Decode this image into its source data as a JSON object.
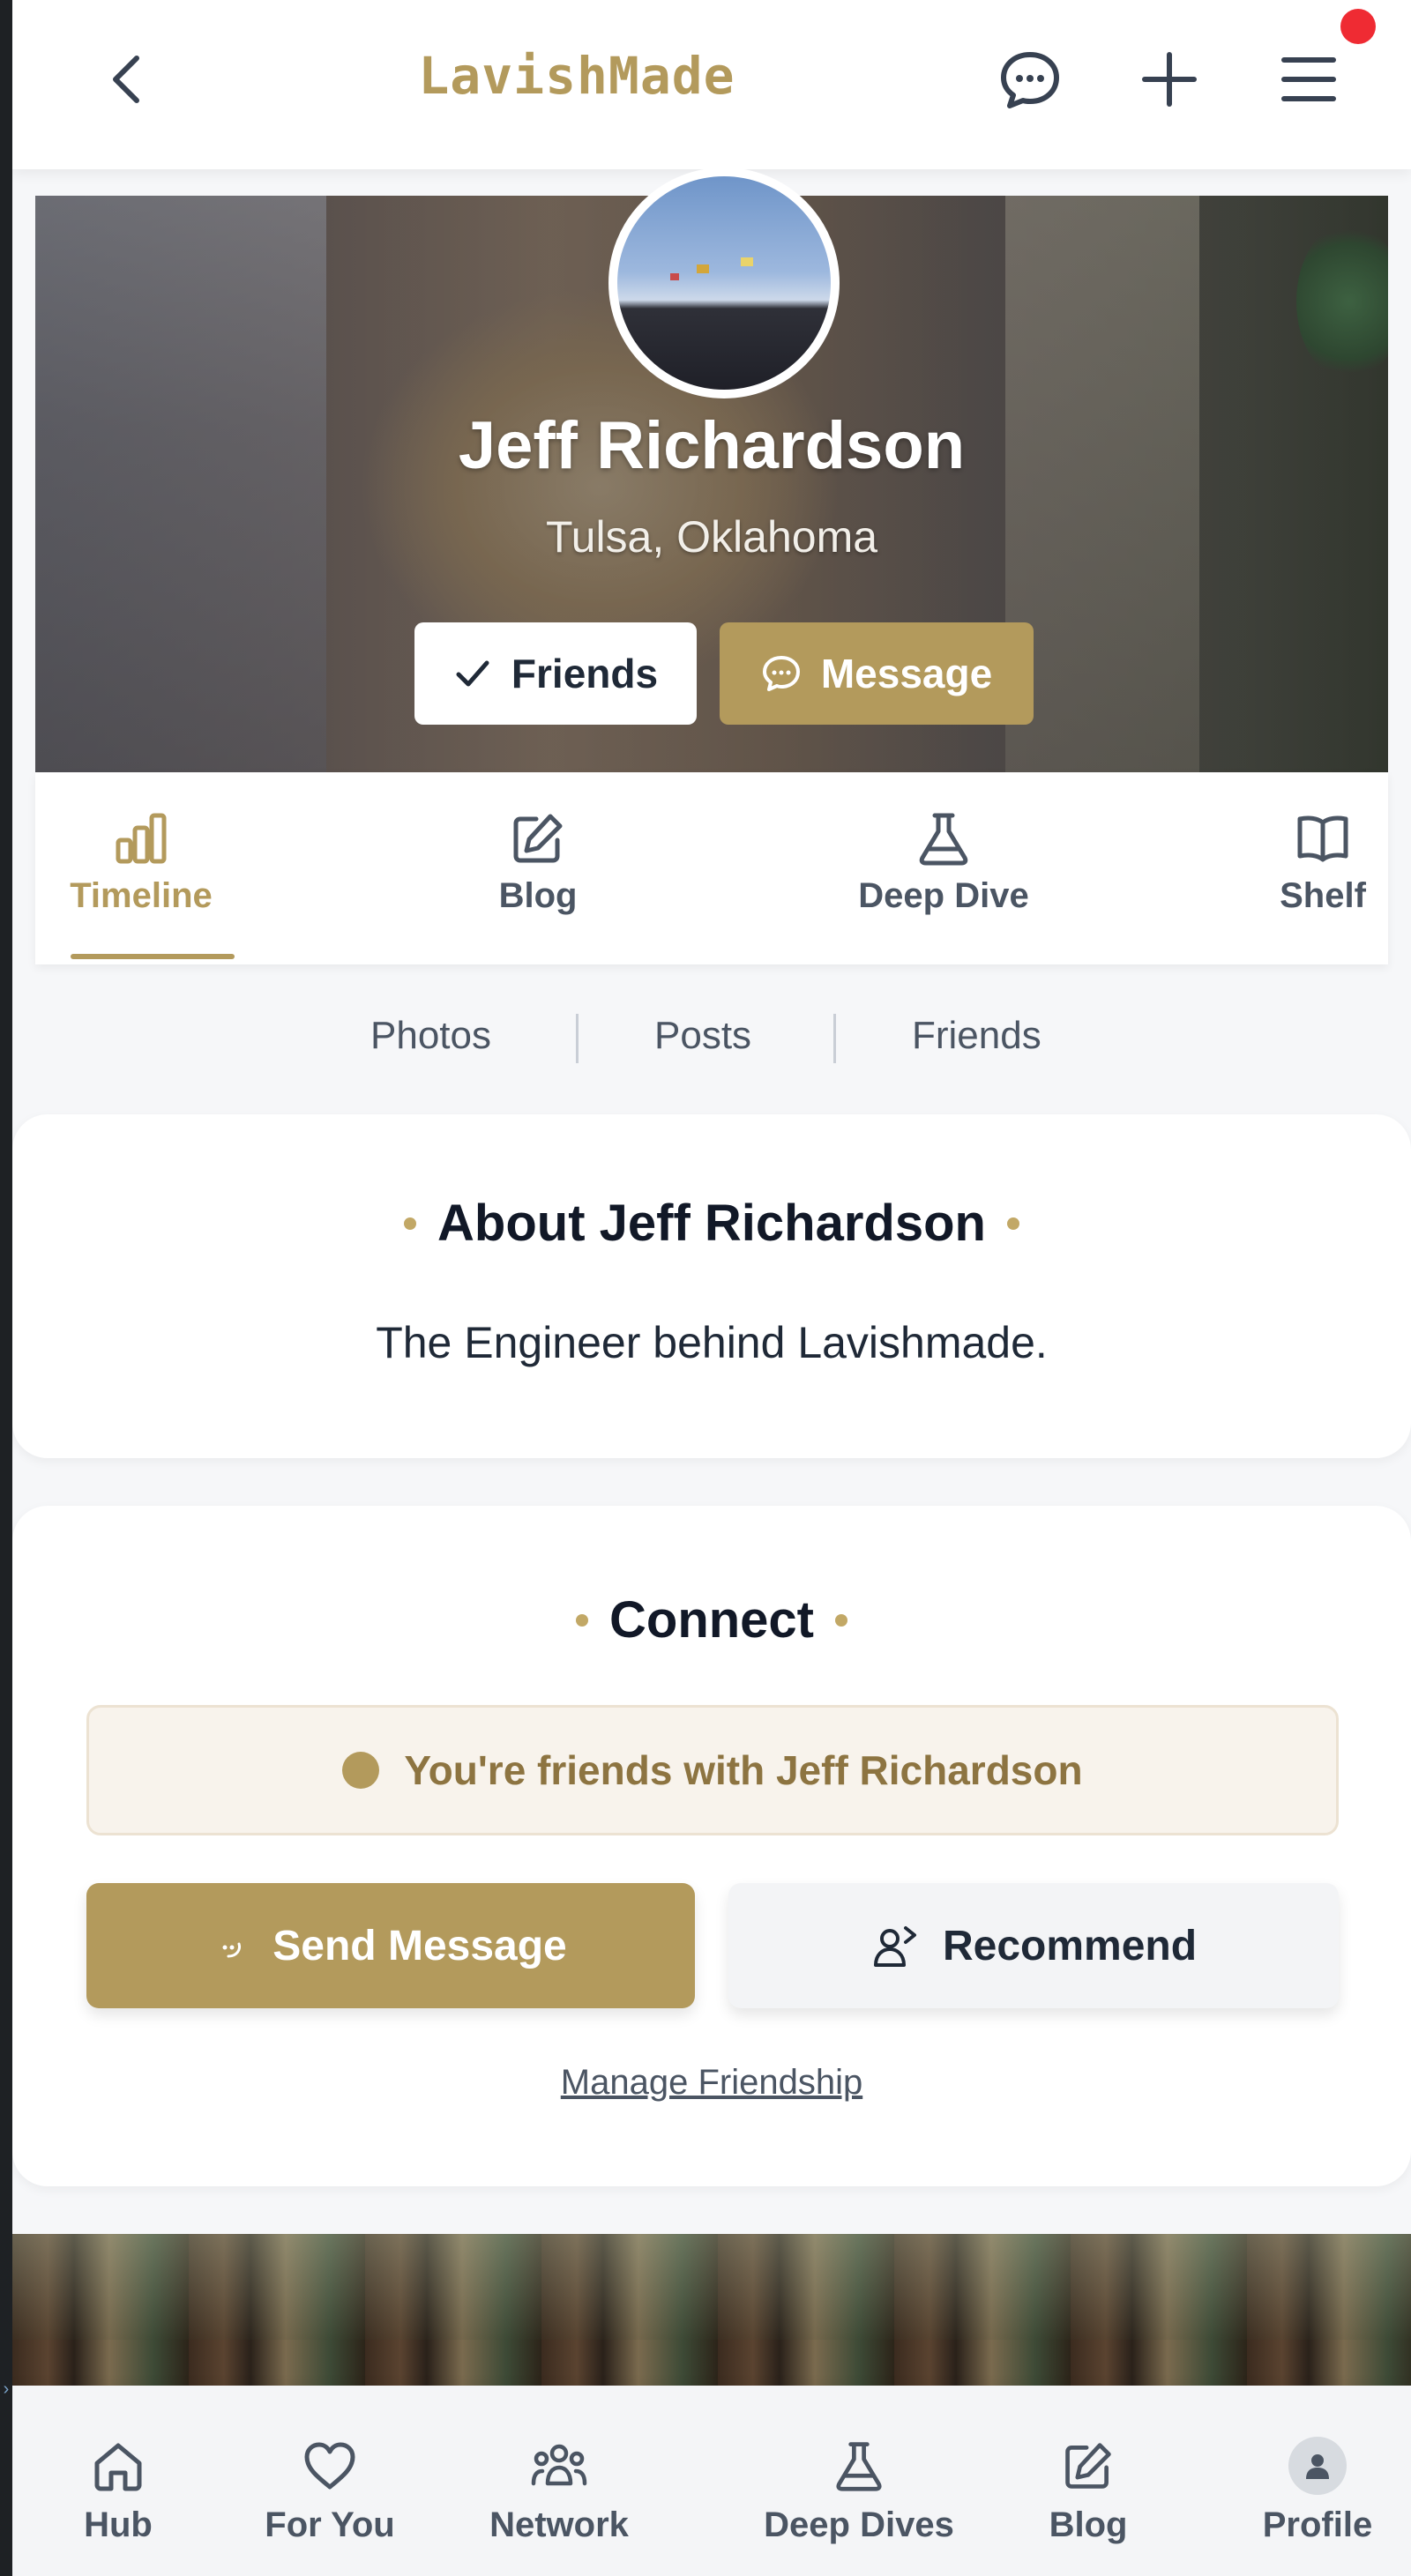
{
  "header": {
    "brand": "LavishMade",
    "icons": [
      "back-chevron-icon",
      "chat-icon",
      "plus-icon",
      "menu-icon"
    ],
    "has_notification": true
  },
  "profile": {
    "name": "Jeff Richardson",
    "location": "Tulsa, Oklahoma",
    "friends_button": "Friends",
    "message_button": "Message"
  },
  "tabs": [
    {
      "label": "Timeline",
      "icon": "bar-chart-icon",
      "active": true
    },
    {
      "label": "Blog",
      "icon": "edit-icon",
      "active": false
    },
    {
      "label": "Deep Dive",
      "icon": "flask-icon",
      "active": false
    },
    {
      "label": "Shelf",
      "icon": "book-icon",
      "active": false
    }
  ],
  "subnav": [
    "Photos",
    "Posts",
    "Friends"
  ],
  "about": {
    "title": "About Jeff Richardson",
    "text": "The Engineer behind Lavishmade."
  },
  "connect": {
    "title": "Connect",
    "status": "You're friends with Jeff Richardson",
    "send_message": "Send Message",
    "recommend": "Recommend",
    "manage_link": "Manage Friendship"
  },
  "bottom_nav": [
    {
      "label": "Hub",
      "icon": "home-icon"
    },
    {
      "label": "For You",
      "icon": "heart-icon"
    },
    {
      "label": "Network",
      "icon": "users-icon"
    },
    {
      "label": "Deep Dives",
      "icon": "flask-icon"
    },
    {
      "label": "Blog",
      "icon": "edit-icon"
    },
    {
      "label": "Profile",
      "icon": "user-icon"
    }
  ],
  "colors": {
    "accent": "#b39a5c",
    "notification": "#ef2b33",
    "status_bg": "#f8f3ec",
    "text_dark": "#111827"
  }
}
